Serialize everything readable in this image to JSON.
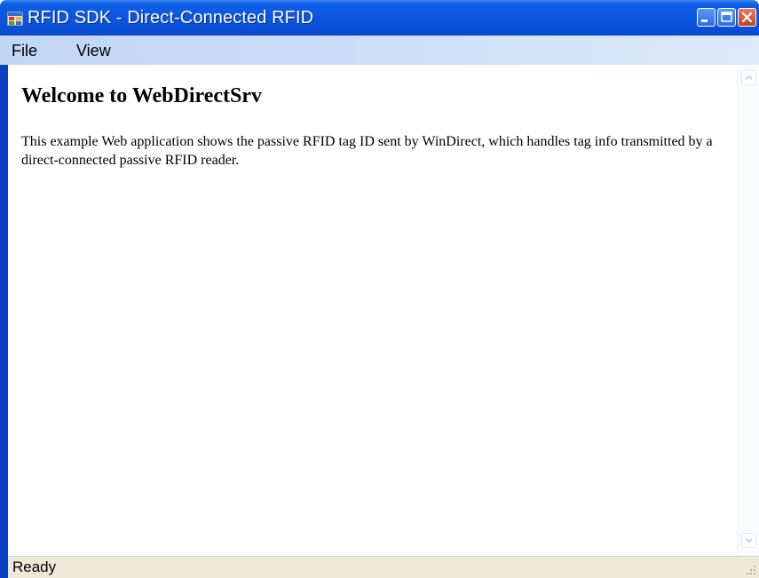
{
  "window": {
    "title": "RFID SDK - Direct-Connected RFID",
    "icon": "app-icon",
    "controls": [
      "minimize-icon",
      "maximize-icon",
      "close-icon"
    ]
  },
  "menu": {
    "items": [
      {
        "label": "File"
      },
      {
        "label": "View"
      }
    ]
  },
  "content": {
    "heading": "Welcome to WebDirectSrv",
    "paragraph": "This example Web application shows the passive RFID tag ID sent by WinDirect, which handles tag info transmitted by a direct-connected passive RFID reader."
  },
  "status": {
    "text": "Ready"
  },
  "colors": {
    "titlebar": "#0b56de",
    "menubar": "#c9dcf7",
    "statusbar": "#ece9d8"
  }
}
